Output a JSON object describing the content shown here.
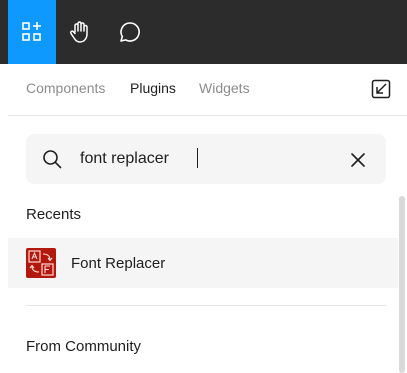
{
  "toolbar": {
    "tools": [
      {
        "icon": "resources-icon",
        "active": true
      },
      {
        "icon": "hand-icon",
        "active": false
      },
      {
        "icon": "comment-icon",
        "active": false
      }
    ],
    "accent_color": "#0d99ff",
    "background_color": "#2c2c2c"
  },
  "tabs": [
    {
      "label": "Components",
      "selected": false
    },
    {
      "label": "Plugins",
      "selected": true
    },
    {
      "label": "Widgets",
      "selected": false
    }
  ],
  "search": {
    "value": "font replacer",
    "placeholder": "Search"
  },
  "sections": {
    "recents": "Recents",
    "community": "From Community"
  },
  "recents": [
    {
      "name": "Font Replacer",
      "thumb_color": "#b3180f"
    }
  ]
}
